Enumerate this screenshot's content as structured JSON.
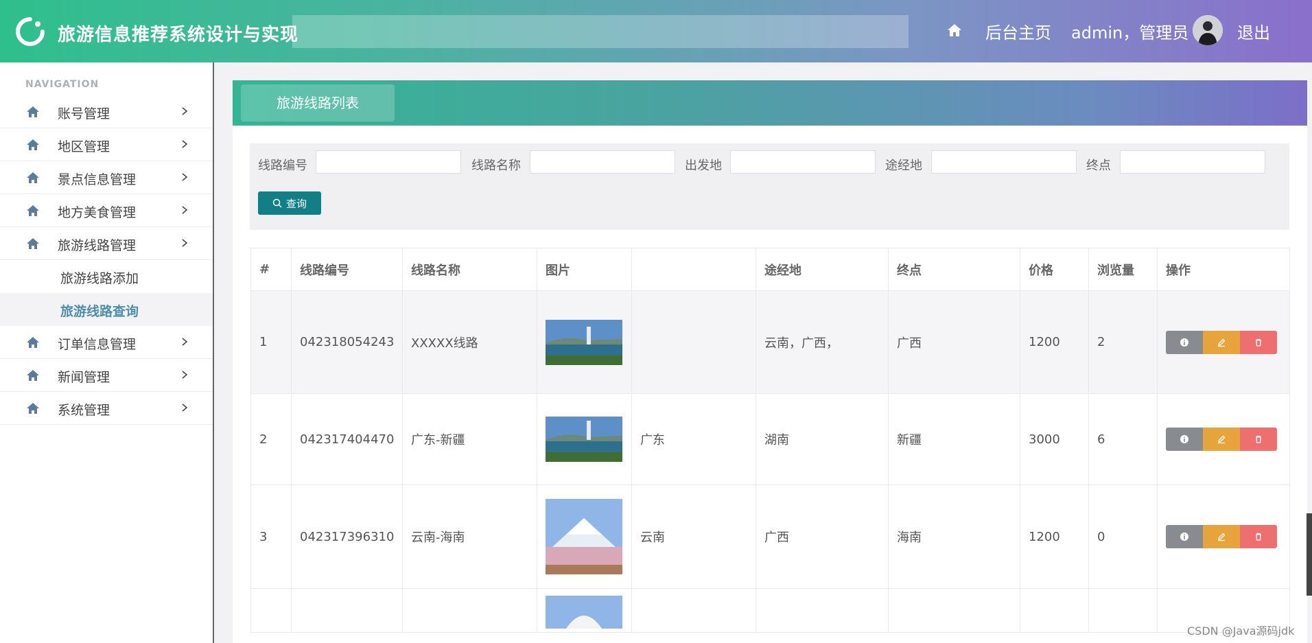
{
  "header": {
    "title": "旅游信息推荐系统设计与实现",
    "home_label": "后台主页",
    "user_label": "admin，管理员",
    "logout_label": "退出"
  },
  "sidebar": {
    "heading": "NAVIGATION",
    "items": [
      {
        "label": "账号管理"
      },
      {
        "label": "地区管理"
      },
      {
        "label": "景点信息管理"
      },
      {
        "label": "地方美食管理"
      },
      {
        "label": "旅游线路管理"
      }
    ],
    "subitems": [
      {
        "label": "旅游线路添加"
      },
      {
        "label": "旅游线路查询"
      }
    ],
    "items_after": [
      {
        "label": "订单信息管理"
      },
      {
        "label": "新闻管理"
      },
      {
        "label": "系统管理"
      }
    ]
  },
  "panel": {
    "tab_label": "旅游线路列表"
  },
  "filters": {
    "route_no_label": "线路编号",
    "route_name_label": "线路名称",
    "departure_label": "出发地",
    "via_label": "途经地",
    "end_label": "终点",
    "search_label": "查询"
  },
  "table": {
    "headers": [
      "#",
      "线路编号",
      "线路名称",
      "图片",
      "",
      "途经地",
      "终点",
      "价格",
      "浏览量",
      "操作"
    ],
    "rows": [
      {
        "idx": "1",
        "code": "042318054243",
        "name": "XXXXX线路",
        "depart": "",
        "via": "云南，广西，",
        "end": "广西",
        "price": "1200",
        "views": "2"
      },
      {
        "idx": "2",
        "code": "042317404470",
        "name": "广东-新疆",
        "depart": "广东",
        "via": "湖南",
        "end": "新疆",
        "price": "3000",
        "views": "6"
      },
      {
        "idx": "3",
        "code": "042317396310",
        "name": "云南-海南",
        "depart": "云南",
        "via": "广西",
        "end": "海南",
        "price": "1200",
        "views": "0"
      }
    ]
  },
  "watermark": "CSDN @Java源码jdk",
  "colors": {
    "accent_teal": "#127e86",
    "view_btn": "#888c90",
    "edit_btn": "#e8a43c",
    "delete_btn": "#ee6f6f"
  }
}
